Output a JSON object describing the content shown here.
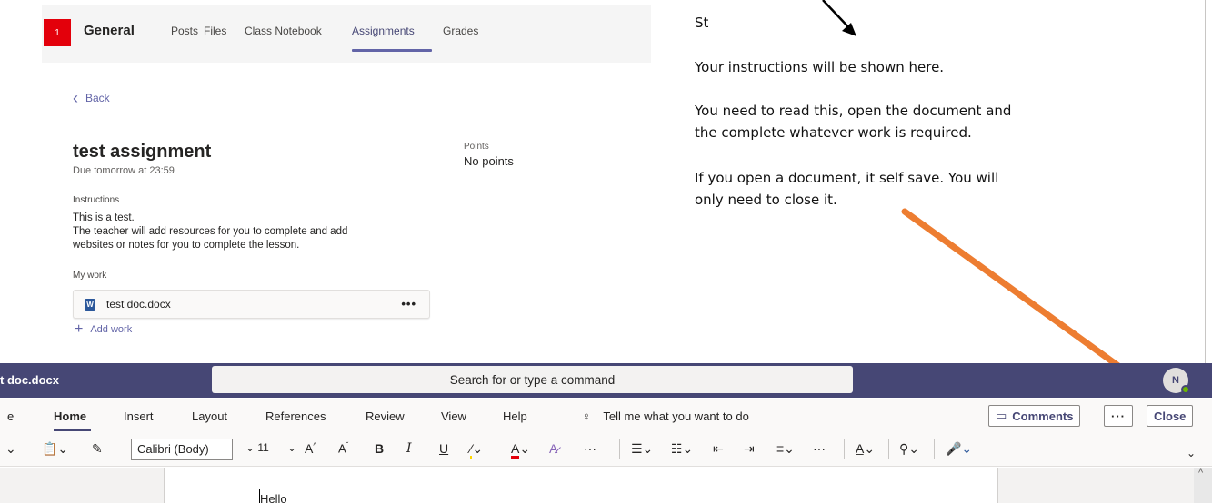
{
  "teams": {
    "team_badge": "1",
    "channel": "General",
    "tabs": [
      "Posts",
      "Files",
      "Class Notebook",
      "Assignments",
      "Grades"
    ],
    "active_tab": "Assignments"
  },
  "assignment": {
    "back_label": "Back",
    "title": "test assignment",
    "due": "Due tomorrow at 23:59",
    "points_label": "Points",
    "points_value": "No points",
    "instructions_label": "Instructions",
    "instructions_lines": [
      "This is a test.",
      "The teacher will add resources for you to  complete and add",
      "websites or notes for  you to complete the lesson."
    ],
    "my_work_label": "My work",
    "work_file": "test doc.docx",
    "work_more": "•••",
    "add_work_label": "Add work"
  },
  "annotation": {
    "fragment": "St",
    "line1": "Your instructions will be shown here.",
    "line2": "You need to read this, open the document and",
    "line3": "the complete whatever work is required.",
    "line4": "If you  open a document, it self save. You will",
    "line5": "only need to close it.",
    "arrow_color": "#ed7d31"
  },
  "word": {
    "doc_title": "t doc.docx",
    "search_placeholder": "Search for or type a command",
    "avatar_initial": "N",
    "ribbon_tabs": [
      "e",
      "Home",
      "Insert",
      "Layout",
      "References",
      "Review",
      "View",
      "Help"
    ],
    "active_ribbon_tab": "Home",
    "tell_me": "Tell me what you want to do",
    "comments_label": "Comments",
    "more_label": "···",
    "close_label": "Close",
    "font_name": "Calibri (Body)",
    "font_size": "11",
    "body_text": "Hello"
  },
  "colors": {
    "teams_purple": "#464775",
    "accent": "#6264a7",
    "badge_red": "#e3000b",
    "arrow_orange": "#ed7d31"
  }
}
